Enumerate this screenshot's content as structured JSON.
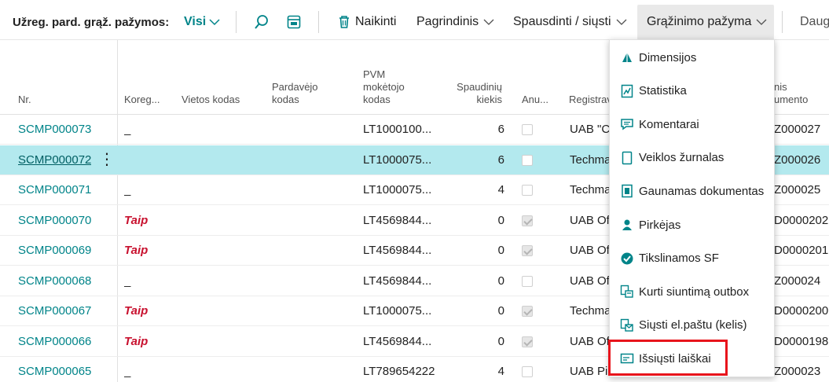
{
  "toolbar": {
    "page_caption": "Užreg. pard. grąž. pažymos:",
    "view_filter": "Visi",
    "delete_label": "Naikinti",
    "main_label": "Pagrindinis",
    "print_label": "Spausdinti / siųsti",
    "return_label": "Grąžinimo pažyma",
    "more_label": "Daug"
  },
  "columns": {
    "nr": "Nr.",
    "korekcija": "Koreg...",
    "vietos": "Vietos kodas",
    "pardavejo_1": "Pardavėjo",
    "pardavejo_2": "kodas",
    "pvm_1": "PVM",
    "pvm_2": "mokėtojo",
    "pvm_3": "kodas",
    "spaud_1": "Spaudinių",
    "spaud_2": "kiekis",
    "anuliuota": "Anu...",
    "registr": "Registrav",
    "doc_1": "nis",
    "doc_2": "umento"
  },
  "rows": [
    {
      "nr": "SCMP000073",
      "kor": "_",
      "pvm": "LT1000100...",
      "qty": "6",
      "checked": false,
      "reg": "UAB \"C",
      "doc": "Z000027"
    },
    {
      "nr": "SCMP000072",
      "kor": "",
      "pvm": "LT1000075...",
      "qty": "6",
      "checked": false,
      "reg": "Techma",
      "doc": "Z000026",
      "selected": true
    },
    {
      "nr": "SCMP000071",
      "kor": "_",
      "pvm": "LT1000075...",
      "qty": "4",
      "checked": false,
      "reg": "Techma",
      "doc": "Z000025"
    },
    {
      "nr": "SCMP000070",
      "kor": "Taip",
      "pvm": "LT4569844...",
      "qty": "0",
      "checked": true,
      "reg": "UAB Of",
      "doc": "D0000202"
    },
    {
      "nr": "SCMP000069",
      "kor": "Taip",
      "pvm": "LT4569844...",
      "qty": "0",
      "checked": true,
      "reg": "UAB Of",
      "doc": "D0000201"
    },
    {
      "nr": "SCMP000068",
      "kor": "_",
      "pvm": "LT4569844...",
      "qty": "0",
      "checked": false,
      "reg": "UAB Of",
      "doc": "Z000024"
    },
    {
      "nr": "SCMP000067",
      "kor": "Taip",
      "pvm": "LT1000075...",
      "qty": "0",
      "checked": true,
      "reg": "Techma",
      "doc": "D0000200"
    },
    {
      "nr": "SCMP000066",
      "kor": "Taip",
      "pvm": "LT4569844...",
      "qty": "0",
      "checked": true,
      "reg": "UAB Of",
      "doc": "D0000198"
    },
    {
      "nr": "SCMP000065",
      "kor": "_",
      "pvm": "LT789654222",
      "qty": "4",
      "checked": false,
      "reg": "UAB Pi",
      "doc": "Z000023"
    }
  ],
  "menu": {
    "items": [
      {
        "label": "Dimensijos",
        "icon": "dimensions-icon"
      },
      {
        "label": "Statistika",
        "icon": "statistics-icon"
      },
      {
        "label": "Komentarai",
        "icon": "comments-icon"
      },
      {
        "label": "Veiklos žurnalas",
        "icon": "activity-log-icon"
      },
      {
        "label": "Gaunamas dokumentas",
        "icon": "incoming-document-icon"
      },
      {
        "label": "Pirkėjas",
        "icon": "customer-icon"
      },
      {
        "label": "Tikslinamos SF",
        "icon": "correction-invoice-icon"
      },
      {
        "label": "Kurti siuntimą outbox",
        "icon": "create-outbox-icon"
      },
      {
        "label": "Siųsti el.paštu (kelis)",
        "icon": "send-email-icon"
      },
      {
        "label": "Išsiųsti laiškai",
        "icon": "sent-emails-icon"
      }
    ]
  },
  "colors": {
    "accent": "#008489",
    "selected_row": "#b3e9ee",
    "taip": "#c8102e",
    "highlight": "#e8141c"
  }
}
